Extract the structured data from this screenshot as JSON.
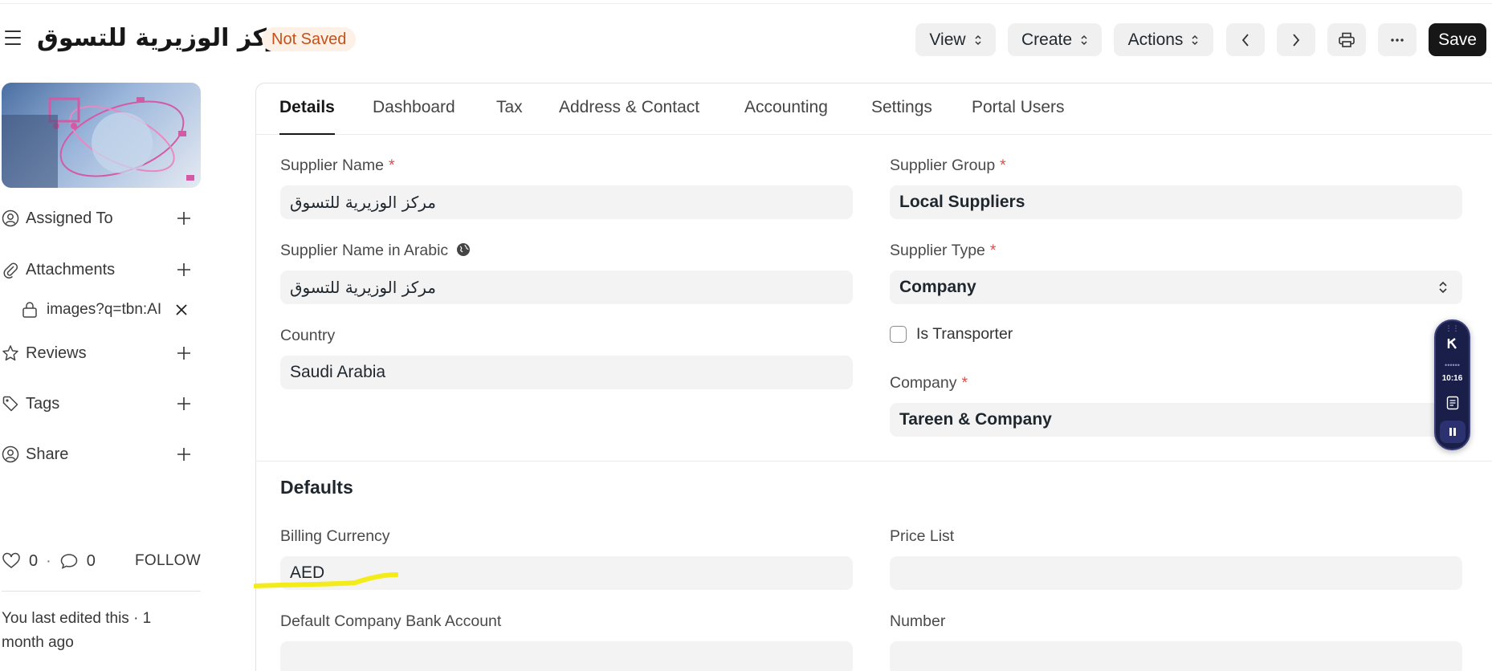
{
  "header": {
    "title": "مركز الوزيرية للتسوق",
    "status": "Not Saved",
    "buttons": {
      "view": "View",
      "create": "Create",
      "actions": "Actions",
      "save": "Save"
    }
  },
  "sidebar": {
    "assigned_to": "Assigned To",
    "attachments": "Attachments",
    "attachment_file": "images?q=tbn:AI",
    "reviews": "Reviews",
    "tags": "Tags",
    "share": "Share",
    "likes": "0",
    "comments": "0",
    "follow": "FOLLOW",
    "last_edited": "You last edited this · 1 month ago"
  },
  "tabs": [
    "Details",
    "Dashboard",
    "Tax",
    "Address & Contact",
    "Accounting",
    "Settings",
    "Portal Users"
  ],
  "active_tab": "Details",
  "form": {
    "supplier_name": {
      "label": "Supplier Name",
      "value": "مركز الوزيرية للتسوق",
      "required": true
    },
    "supplier_name_ar": {
      "label": "Supplier Name in Arabic",
      "value": "مركز الوزيرية للتسوق"
    },
    "country": {
      "label": "Country",
      "value": "Saudi Arabia"
    },
    "supplier_group": {
      "label": "Supplier Group",
      "value": "Local Suppliers",
      "required": true
    },
    "supplier_type": {
      "label": "Supplier Type",
      "value": "Company",
      "required": true
    },
    "is_transporter": {
      "label": "Is Transporter",
      "checked": false
    },
    "company": {
      "label": "Company",
      "value": "Tareen & Company",
      "required": true
    }
  },
  "defaults": {
    "title": "Defaults",
    "billing_currency": {
      "label": "Billing Currency",
      "value": "AED"
    },
    "price_list": {
      "label": "Price List",
      "value": ""
    },
    "bank_account": {
      "label": "Default Company Bank Account",
      "value": ""
    },
    "number": {
      "label": "Number",
      "value": ""
    }
  },
  "recorder": {
    "time": "10:16"
  },
  "colors": {
    "status_bg": "#fdf0e6",
    "status_text": "#c4511b",
    "highlight": "#f4ec1a",
    "required": "#e24c4c"
  }
}
